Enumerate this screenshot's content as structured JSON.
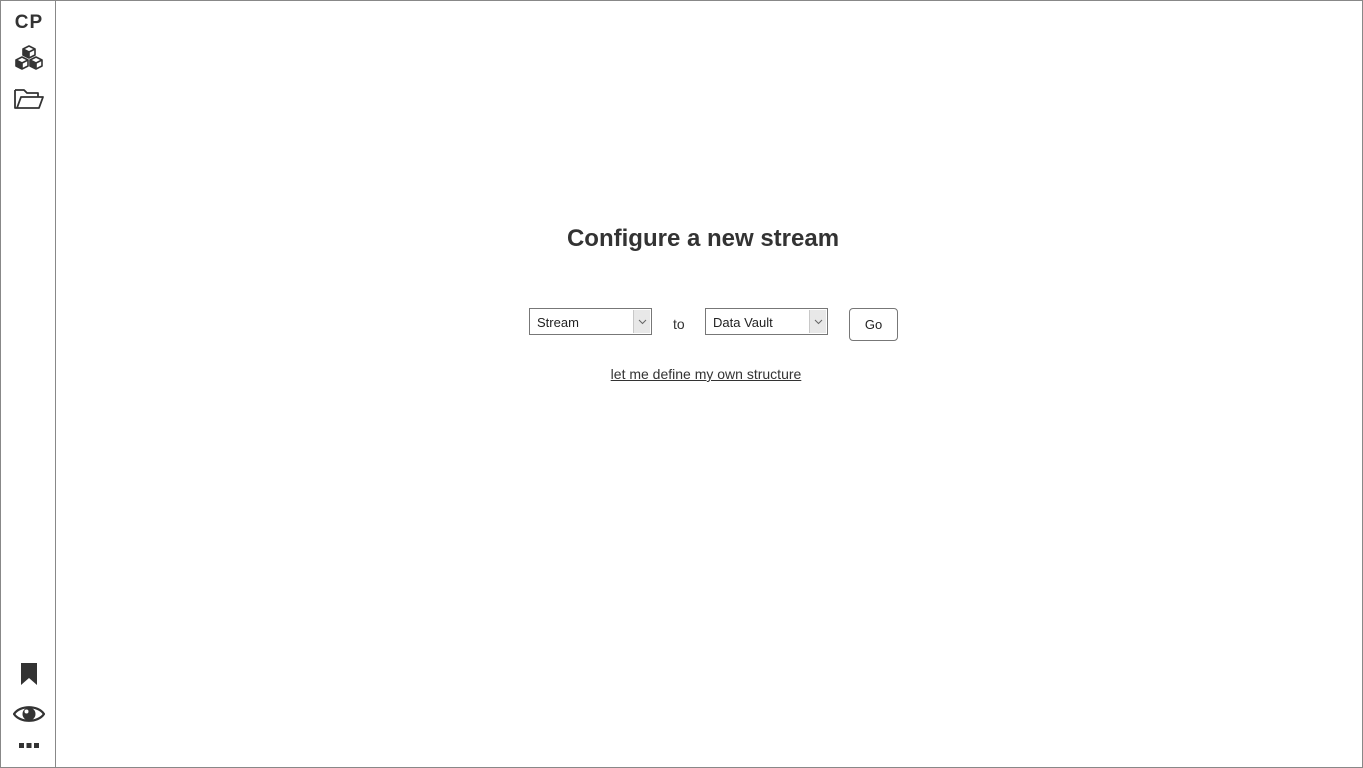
{
  "sidebar": {
    "logo": "CP",
    "top_icons": [
      "cubes-icon",
      "open-folder-icon"
    ],
    "bottom_icons": [
      "bookmark-icon",
      "eye-icon",
      "more-dots-icon"
    ]
  },
  "main": {
    "title": "Configure a new stream",
    "source_select": {
      "value": "Stream"
    },
    "connector_label": "to",
    "target_select": {
      "value": "Data Vault"
    },
    "go_label": "Go",
    "custom_structure_link": "let me define my own structure"
  },
  "colors": {
    "text": "#333333",
    "border": "#888888",
    "background": "#ffffff"
  }
}
